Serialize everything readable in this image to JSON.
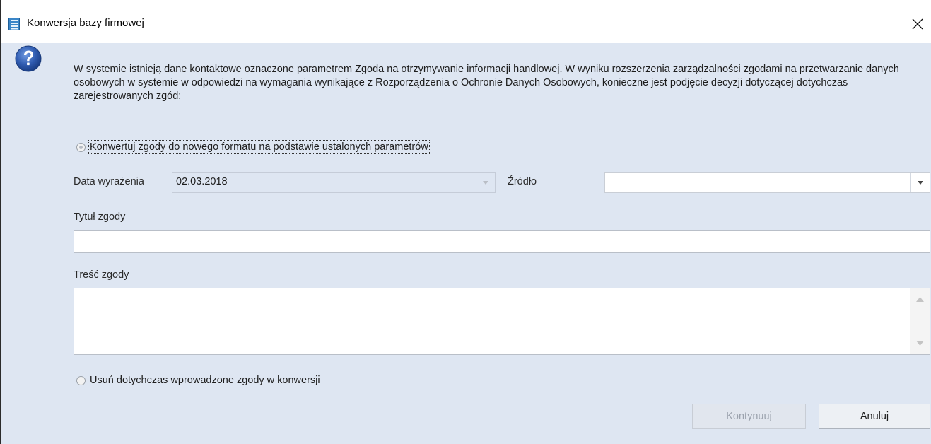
{
  "window": {
    "title": "Konwersja bazy firmowej",
    "close_icon": "close-icon"
  },
  "message": "W systemie istnieją dane kontaktowe oznaczone parametrem Zgoda na otrzymywanie informacji handlowej. W wyniku rozszerzenia zarządzalności zgodami na przetwarzanie danych osobowych w systemie w odpowiedzi na wymagania wynikające z Rozporządzenia o Ochronie Danych Osobowych, konieczne jest podjęcie decyzji dotyczącej dotychczas zarejestrowanych zgód:",
  "options": {
    "convert": {
      "label": "Konwertuj zgody do nowego formatu na podstawie ustalonych parametrów",
      "selected": true
    },
    "delete": {
      "label": "Usuń dotychczas wprowadzone zgody w konwersji",
      "selected": false
    }
  },
  "form": {
    "date_label": "Data wyrażenia",
    "date_value": "02.03.2018",
    "source_label": "Źródło",
    "source_value": "",
    "title_label": "Tytuł zgody",
    "title_value": "",
    "content_label": "Treść zgody",
    "content_value": ""
  },
  "buttons": {
    "continue": "Kontynuuj",
    "cancel": "Anuluj"
  },
  "colors": {
    "client_bg": "#dee6f2",
    "question_icon": "#2b59a8"
  }
}
